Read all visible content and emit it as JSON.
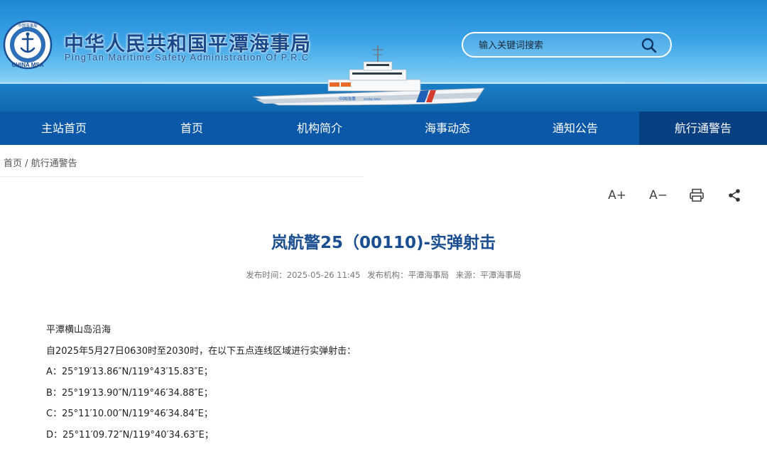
{
  "header": {
    "site_name": "中华人民共和国平潭海事局",
    "site_name_en": "PingTan Maritime Safety Administration Of P.R.C",
    "logo_text": "CHINA MSA",
    "logo_top_text": "中国海事局",
    "search_placeholder": "输入关键词搜索"
  },
  "nav": {
    "items": [
      {
        "label": "主站首页"
      },
      {
        "label": "首页"
      },
      {
        "label": "机构简介"
      },
      {
        "label": "海事动态"
      },
      {
        "label": "通知公告"
      },
      {
        "label": "航行通警告"
      }
    ],
    "active_index": 5
  },
  "breadcrumb": {
    "home": "首页",
    "sep": "/",
    "current": "航行通警告"
  },
  "tools": {
    "font_up": "A+",
    "font_down": "A−"
  },
  "article": {
    "title": "岚航警25（00110)-实弹射击",
    "publish_time_label": "发布时间：",
    "publish_time": "2025-05-26 11:45",
    "org_label": "发布机构：",
    "org": "平潭海事局",
    "source_label": "来源：",
    "source": "平潭海事局",
    "paragraphs": [
      "平潭横山岛沿海",
      "自2025年5月27日0630时至2030时，在以下五点连线区域进行实弹射击：",
      "A：25°19′13.86″N/119°43′15.83″E；",
      "B：25°19′13.90″N/119°46′34.88″E；",
      "C：25°11′10.00″N/119°46′34.84″E；",
      "D：25°11′09.72″N/119°40′34.63″E；"
    ]
  },
  "colors": {
    "nav_bg": "#0b58a8",
    "nav_active": "#083f80",
    "title": "#1b4e91"
  }
}
